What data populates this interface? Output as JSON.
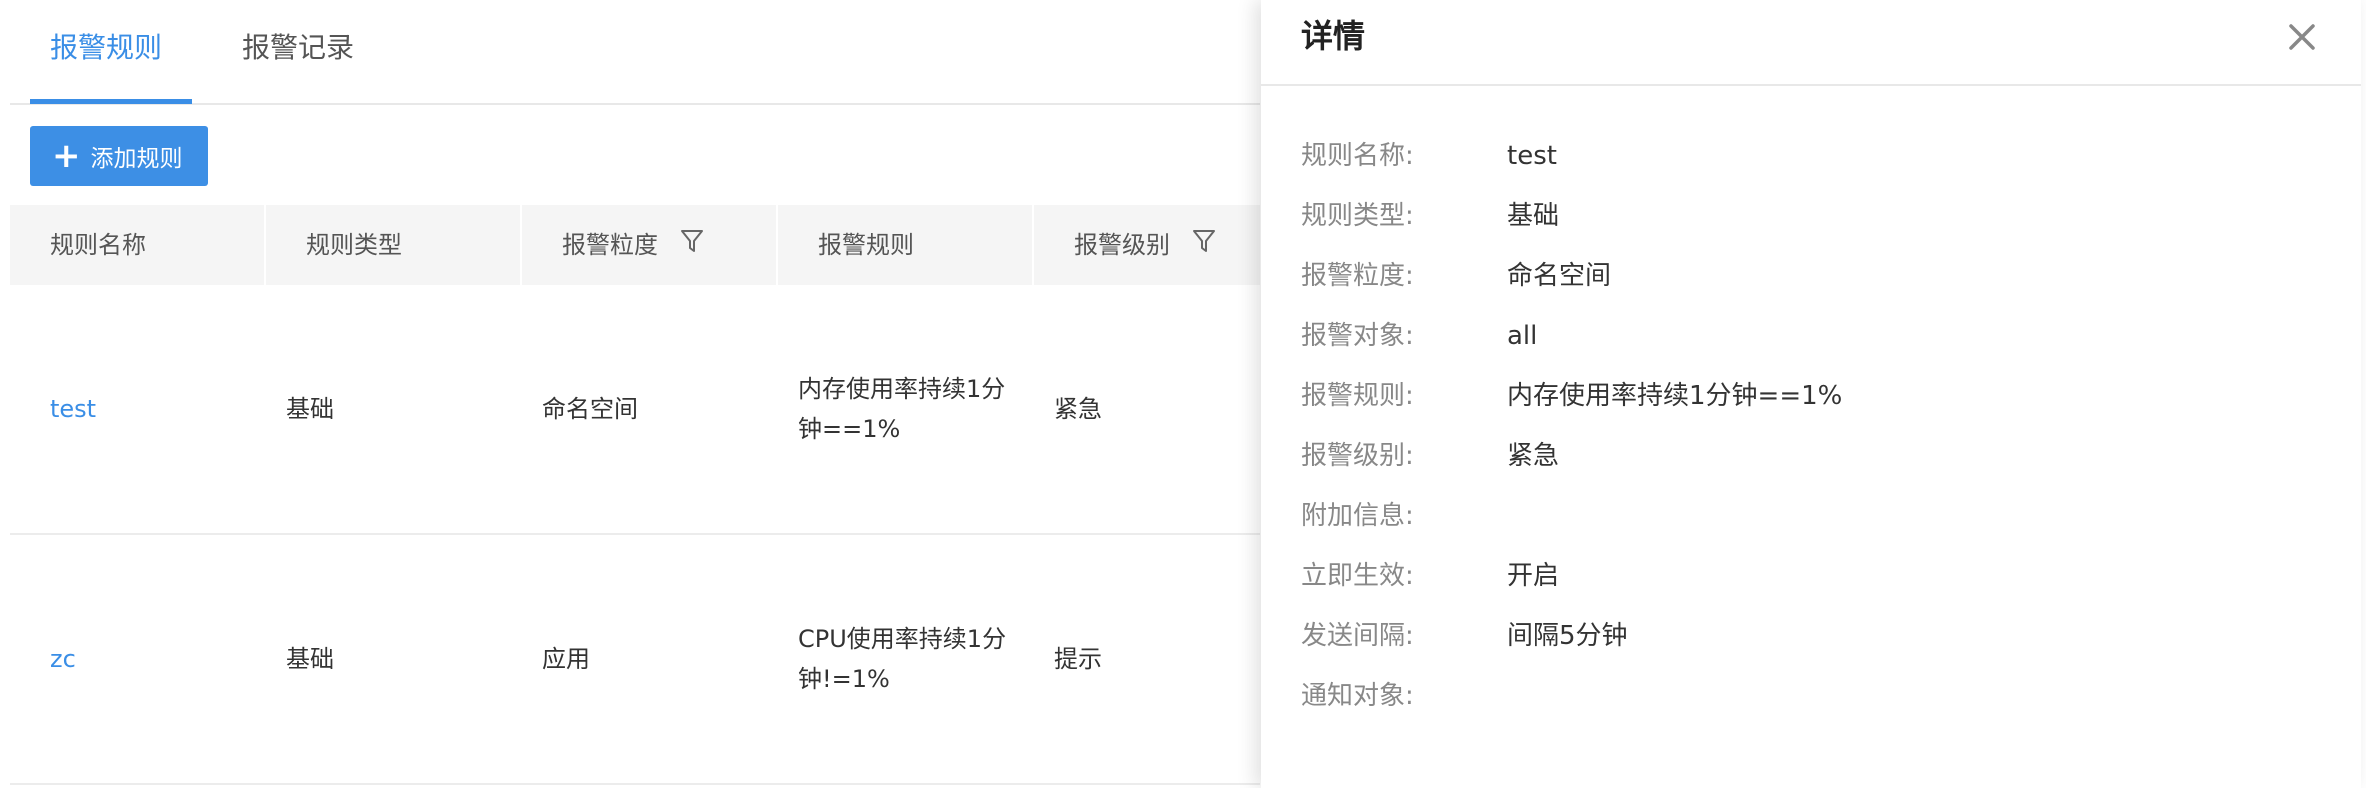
{
  "tabs": [
    {
      "label": "报警规则",
      "active": true
    },
    {
      "label": "报警记录",
      "active": false
    }
  ],
  "toolbar": {
    "add_button_label": "添加规则",
    "add_icon": "plus-icon"
  },
  "table": {
    "headers": [
      {
        "label": "规则名称",
        "filter": false
      },
      {
        "label": "规则类型",
        "filter": false
      },
      {
        "label": "报警粒度",
        "filter": true
      },
      {
        "label": "报警规则",
        "filter": false
      },
      {
        "label": "报警级别",
        "filter": true
      }
    ],
    "rows": [
      {
        "name": "test",
        "type": "基础",
        "granularity": "命名空间",
        "rule_line1": "内存使用率持续1分",
        "rule_line2": "钟==1%",
        "level": "紧急"
      },
      {
        "name": "zc",
        "type": "基础",
        "granularity": "应用",
        "rule_line1": "CPU使用率持续1分",
        "rule_line2": "钟!=1%",
        "level": "提示"
      }
    ]
  },
  "panel": {
    "title": "详情",
    "close_icon": "close-icon",
    "details": [
      {
        "key": "规则名称:",
        "value": "test"
      },
      {
        "key": "规则类型:",
        "value": "基础"
      },
      {
        "key": "报警粒度:",
        "value": "命名空间"
      },
      {
        "key": "报警对象:",
        "value": "all"
      },
      {
        "key": "报警规则:",
        "value": "内存使用率持续1分钟==1%"
      },
      {
        "key": "报警级别:",
        "value": "紧急"
      },
      {
        "key": "附加信息:",
        "value": ""
      },
      {
        "key": "立即生效:",
        "value": "开启"
      },
      {
        "key": "发送间隔:",
        "value": "间隔5分钟"
      },
      {
        "key": "通知对象:",
        "value": ""
      }
    ]
  },
  "colors": {
    "accent": "#3a8ee6",
    "header_bg": "#f5f5f5",
    "label_gray": "#888888"
  }
}
